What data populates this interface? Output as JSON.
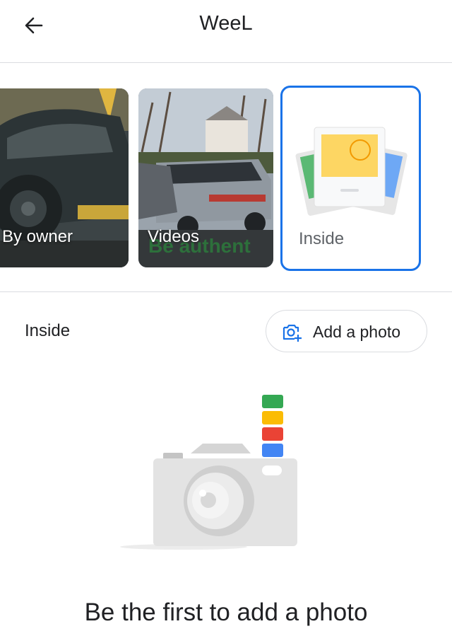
{
  "header": {
    "title": "WeeL",
    "back_icon": "arrow-back-icon"
  },
  "tiles": [
    {
      "label": "By owner",
      "image": "black SUV parked in driveway"
    },
    {
      "label": "Videos",
      "image": "parked cars in lot",
      "watermark": "Be authent"
    },
    {
      "label": "Inside",
      "image": "photo-stack-icon",
      "selected": true
    }
  ],
  "section": {
    "label": "Inside",
    "add_photo_label": "Add a photo",
    "add_photo_icon": "add-photo-icon"
  },
  "empty_state": {
    "illustration": "camera-illustration",
    "message": "Be the first to add a photo"
  },
  "colors": {
    "accent": "#1a73e8",
    "divider": "#dadce0",
    "google_green": "#34a853",
    "google_yellow": "#fbbc04",
    "google_red": "#ea4335",
    "google_blue": "#4285f4"
  }
}
